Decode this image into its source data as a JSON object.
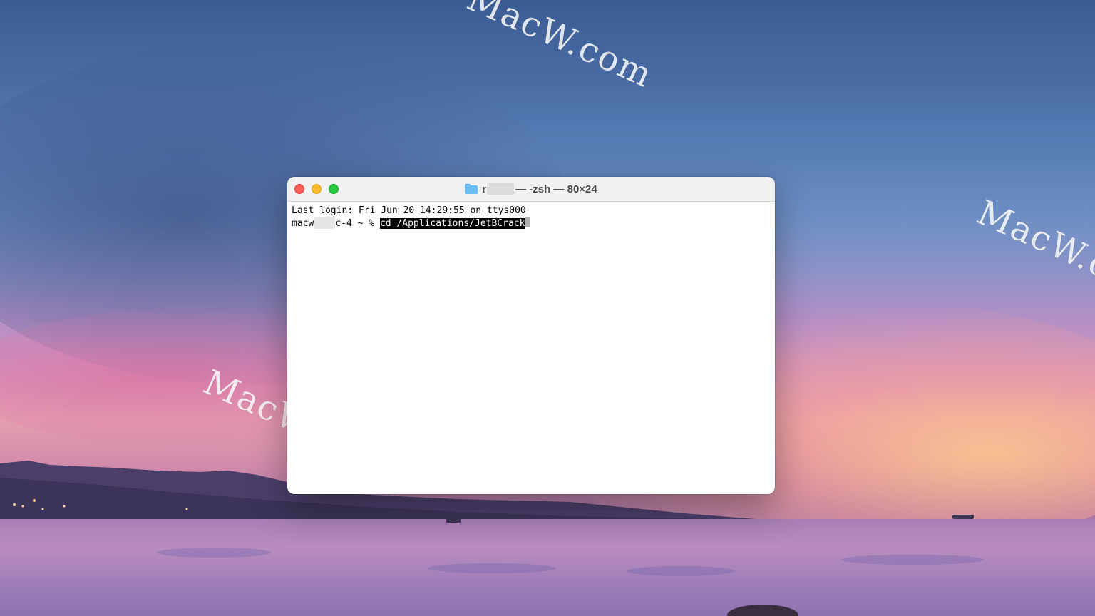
{
  "desktop": {
    "watermarks": [
      "MacW.com",
      "MacW.com",
      "MacW.com"
    ]
  },
  "terminal": {
    "title": {
      "prefix": "r",
      "suffix": "— -zsh — 80×24"
    },
    "lines": [
      {
        "text": "Last login: Fri Jun 20 14:29:55 on ttys000"
      }
    ],
    "prompt": {
      "user_prefix": "macw",
      "host_suffix": "c-4 ~ % ",
      "command": "cd /Applications/JetBCrack"
    }
  },
  "colors": {
    "close": "#fe5f57",
    "minimize": "#febc2e",
    "maximize": "#28c840"
  }
}
